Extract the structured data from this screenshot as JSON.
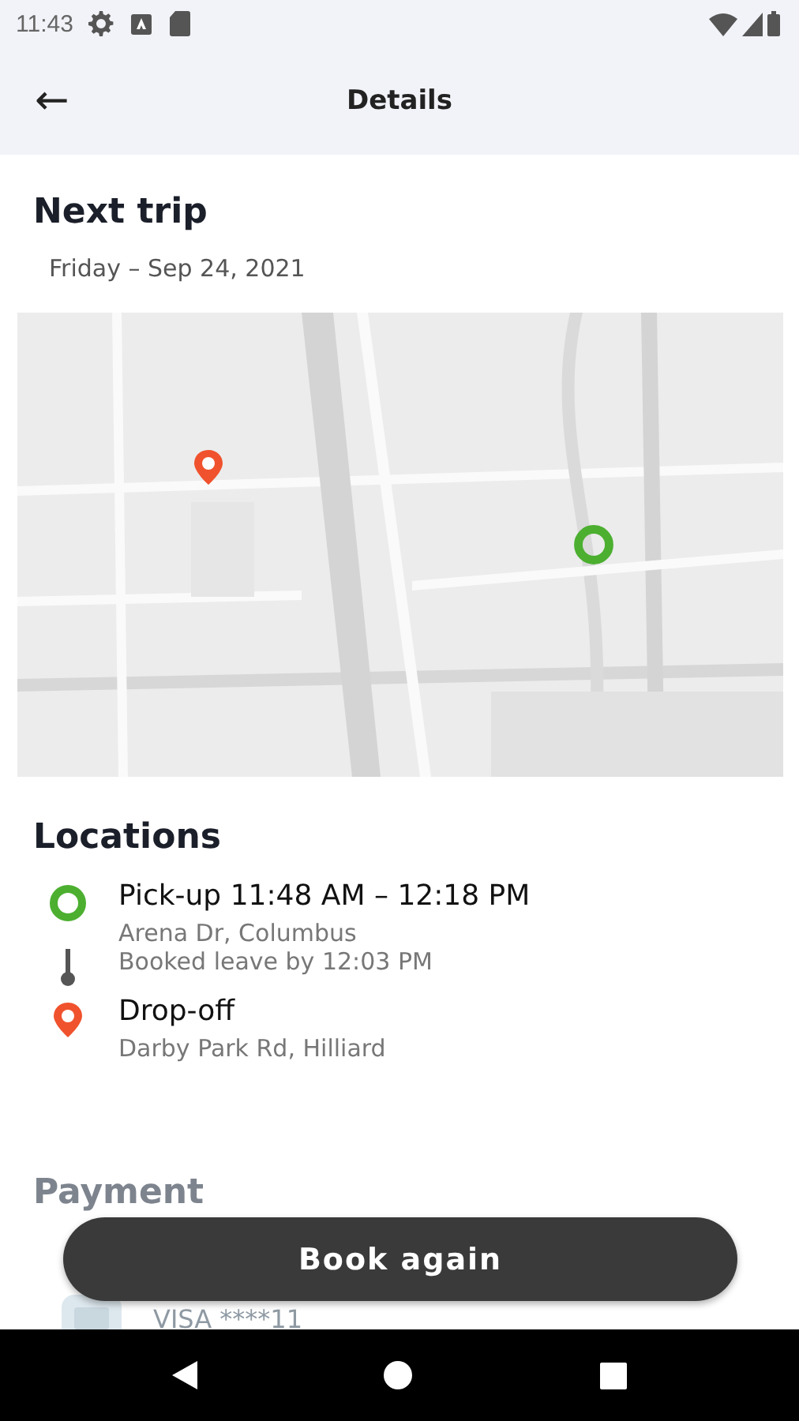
{
  "status_bar": {
    "time": "11:43"
  },
  "header": {
    "back": "←",
    "title": "Details"
  },
  "trip": {
    "heading": "Next trip",
    "date": "Friday – Sep 24, 2021"
  },
  "map": {
    "markers": [
      {
        "kind": "dropoff",
        "color": "#f0522d"
      },
      {
        "kind": "pickup",
        "color": "#4caf30"
      }
    ]
  },
  "locations": {
    "heading": "Locations",
    "items": [
      {
        "kind": "pickup",
        "color": "#4caf30",
        "title": "Pick-up 11:48 AM – 12:18 PM",
        "lines": [
          "Arena Dr, Columbus"
        ]
      },
      {
        "kind": "leave",
        "lines": [
          "Booked leave by 12:03 PM"
        ]
      },
      {
        "kind": "dropoff",
        "color": "#f0522d",
        "title": "Drop-off",
        "lines": [
          "Darby Park Rd, Hilliard"
        ]
      }
    ]
  },
  "payment": {
    "heading": "Payment",
    "card": "VISA ****11"
  },
  "action": {
    "label": "Book again"
  }
}
